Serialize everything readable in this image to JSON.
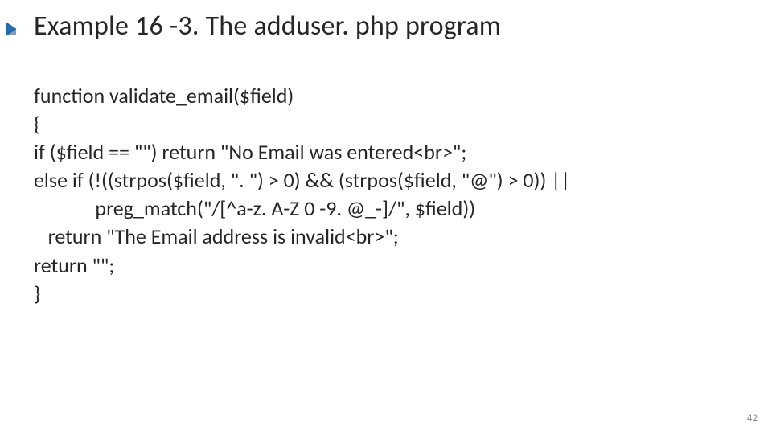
{
  "title": "Example 16 -3. The adduser. php program",
  "code_lines": [
    "function validate_email($field)",
    "{",
    "if ($field == \"\") return \"No Email was entered<br>\";",
    "else if (!((strpos($field, \". \") > 0) && (strpos($field, \"@\") > 0)) ||",
    "             preg_match(\"/[^a-z. A-Z 0 -9. @_-]/\", $field))",
    "   return \"The Email address is invalid<br>\";",
    "return \"\";",
    "}"
  ],
  "page_number": "42",
  "icon_name": "bullet-arrow-icon"
}
